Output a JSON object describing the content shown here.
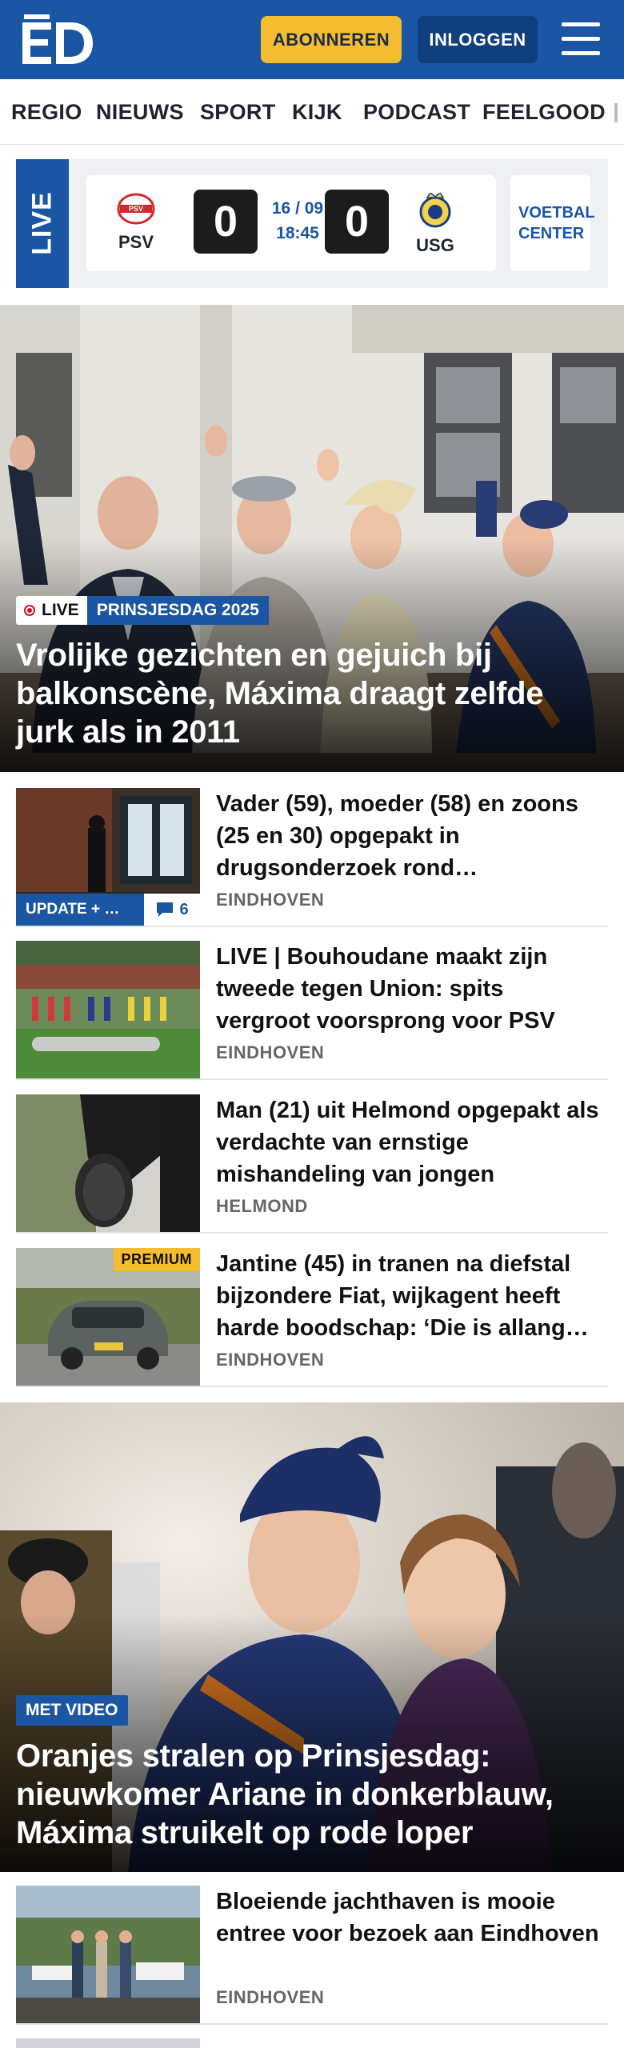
{
  "header": {
    "logo": "ED",
    "subscribe_label": "ABONNEREN",
    "login_label": "INLOGGEN",
    "menu_icon": "hamburger-icon",
    "brand_color": "#1a56a3",
    "accent_color": "#f4bd2f"
  },
  "nav": {
    "items": [
      "REGIO",
      "NIEUWS",
      "SPORT",
      "KIJK",
      "PODCAST",
      "FEELGOOD"
    ]
  },
  "live": {
    "tab_label": "LIVE",
    "home_team": "PSV",
    "away_team": "USG",
    "home_score": "0",
    "away_score": "0",
    "date": "16 / 09",
    "time": "18:45",
    "center_label": "VOETBAL CENTER"
  },
  "hero1": {
    "live_label": "LIVE",
    "topic": "PRINSJESDAG 2025",
    "title": "Vrolijke gezichten en gejuich bij balkonscène, Máxima draagt zelfde jurk als in 2011"
  },
  "articles": [
    {
      "title": "Vader (59), moeder (58) en zoons (25 en 30) opgepakt in drugsonderzoek rond…",
      "location": "EINDHOVEN",
      "update_label": "UPDATE + …",
      "comments": "6"
    },
    {
      "title": "LIVE | Bouhoudane maakt zijn tweede tegen Union: spits vergroot voorsprong voor PSV",
      "location": "EINDHOVEN"
    },
    {
      "title": "Man (21) uit Helmond opgepakt als verdachte van ernstige mishandeling van jongen",
      "location": "HELMOND"
    },
    {
      "title": "Jantine (45) in tranen na diefstal bijzondere Fiat, wijkagent heeft harde boodschap: ‘Die is allang…",
      "location": "EINDHOVEN",
      "premium_label": "PREMIUM"
    }
  ],
  "hero2": {
    "badge": "MET VIDEO",
    "title": "Oranjes stralen op Prinsjesdag: nieuwkomer Ariane in donkerblauw, Máxima struikelt op rode loper"
  },
  "articles2": [
    {
      "title": "Bloeiende jachthaven is mooie entree voor bezoek aan Eindhoven",
      "location": "EINDHOVEN"
    }
  ]
}
